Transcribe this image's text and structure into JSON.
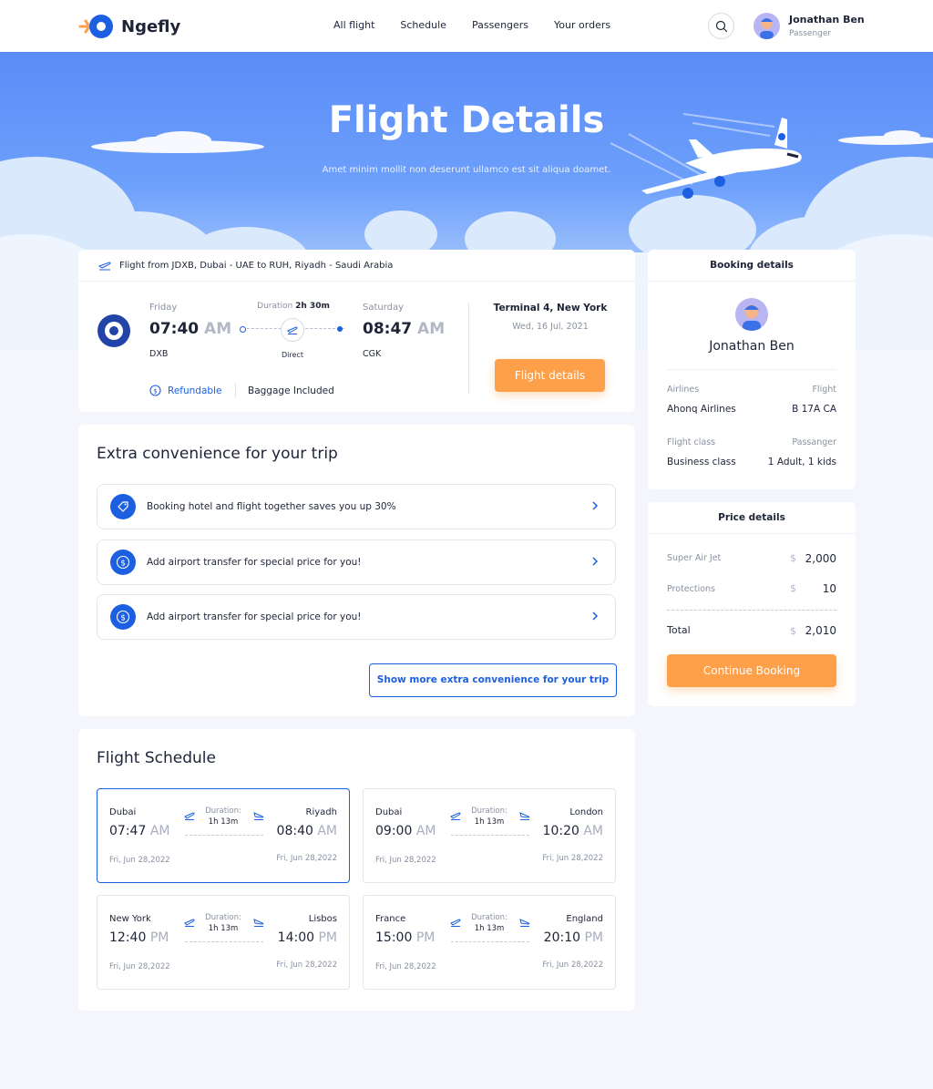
{
  "brand": {
    "name": "Ngefly"
  },
  "nav": {
    "links": [
      "All flight",
      "Schedule",
      "Passengers",
      "Your orders"
    ]
  },
  "user": {
    "name": "Jonathan Ben",
    "role": "Passenger"
  },
  "hero": {
    "title": "Flight Details",
    "subtitle": "Amet minim mollit non deserunt ullamco est sit aliqua doamet."
  },
  "flight": {
    "route": "Flight from JDXB, Dubai - UAE to RUH, Riyadh - Saudi Arabia",
    "dep_day": "Friday",
    "dep_time": "07:40",
    "dep_ampm": "AM",
    "dep_code": "DXB",
    "duration_label": "Duration",
    "duration_value": "2h 30m",
    "stop": "Direct",
    "arr_day": "Saturday",
    "arr_time": "08:47",
    "arr_ampm": "AM",
    "arr_code": "CGK",
    "refundable": "Refundable",
    "baggage": "Baggage Included",
    "terminal": "Terminal 4, New York",
    "date": "Wed, 16 Jul, 2021",
    "details_button": "Flight details"
  },
  "extras": {
    "title": "Extra convenience for your trip",
    "items": [
      "Booking hotel and flight together saves you up 30%",
      "Add airport transfer for special price for you!",
      "Add airport transfer for special price for you!"
    ],
    "more_button": "Show more extra convenience for your trip"
  },
  "schedule": {
    "title": "Flight Schedule",
    "duration_label": "Duration:",
    "items": [
      {
        "from": "Dubai",
        "to": "Riyadh",
        "dep": "07:47",
        "dep_ampm": "AM",
        "arr": "08:40",
        "arr_ampm": "AM",
        "duration": "1h 13m",
        "dep_date": "Fri, Jun 28,2022",
        "arr_date": "Fri, Jun 28,2022"
      },
      {
        "from": "Dubai",
        "to": "London",
        "dep": "09:00",
        "dep_ampm": "AM",
        "arr": "10:20",
        "arr_ampm": "AM",
        "duration": "1h 13m",
        "dep_date": "Fri, Jun 28,2022",
        "arr_date": "Fri, Jun 28,2022"
      },
      {
        "from": "New York",
        "to": "Lisbos",
        "dep": "12:40",
        "dep_ampm": "PM",
        "arr": "14:00",
        "arr_ampm": "PM",
        "duration": "1h 13m",
        "dep_date": "Fri, Jun 28,2022",
        "arr_date": "Fri, Jun 28,2022"
      },
      {
        "from": "France",
        "to": "England",
        "dep": "15:00",
        "dep_ampm": "PM",
        "arr": "20:10",
        "arr_ampm": "PM",
        "duration": "1h 13m",
        "dep_date": "Fri, Jun 28,2022",
        "arr_date": "Fri, Jun 28,2022"
      }
    ]
  },
  "booking": {
    "title": "Booking details",
    "name": "Jonathan Ben",
    "airlines_label": "Airlines",
    "airlines_value": "Ahonq Airlines",
    "flight_label": "Flight",
    "flight_value": "B 17A CA",
    "class_label": "Flight class",
    "class_value": "Business class",
    "passenger_label": "Passanger",
    "passenger_value": "1 Adult, 1 kids"
  },
  "price": {
    "title": "Price details",
    "currency": "$",
    "rows": [
      {
        "label": "Super Air Jet",
        "value": "2,000"
      },
      {
        "label": "Protections",
        "value": "10"
      }
    ],
    "total_label": "Total",
    "total_value": "2,010",
    "continue_button": "Continue Booking"
  },
  "colors": {
    "primary": "#1c5fe0",
    "accent": "#fda049",
    "sky": "#5b8cf9"
  }
}
